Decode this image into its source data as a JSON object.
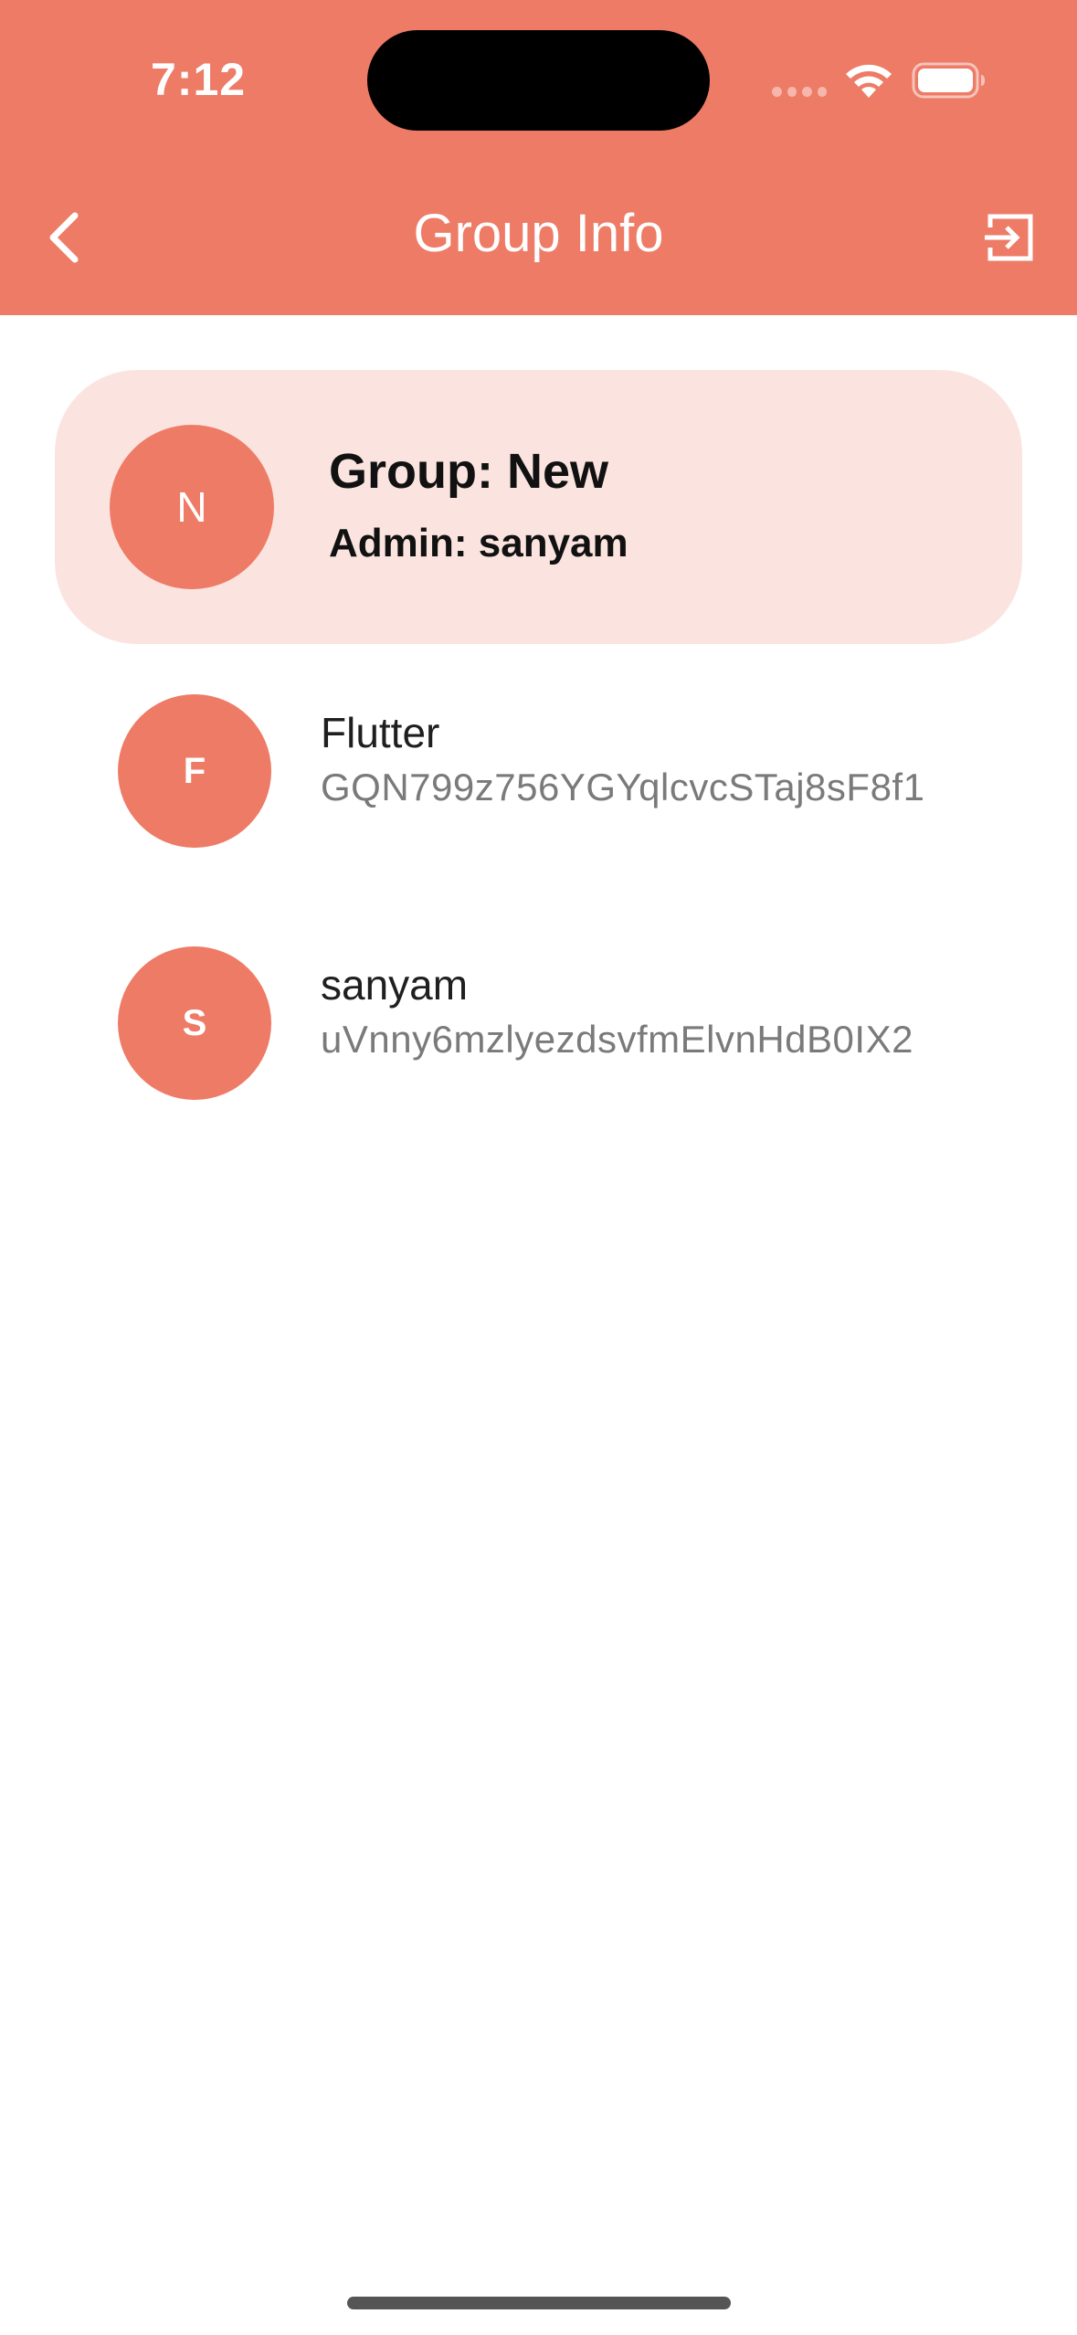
{
  "status_bar": {
    "time": "7:12"
  },
  "header": {
    "title": "Group Info",
    "background_color": "#EE7B66",
    "back_icon": "chevron-left-icon",
    "exit_icon": "exit-to-app-icon"
  },
  "group": {
    "avatar_initial": "N",
    "name_label": "Group: New",
    "admin_label": "Admin: sanyam",
    "card_color": "#FBE4DF"
  },
  "members": [
    {
      "initial": "F",
      "name": "Flutter",
      "id": "GQN799z756YGYqlcvcSTaj8sF8f1"
    },
    {
      "initial": "S",
      "name": "sanyam",
      "id": "uVnny6mzlyezdsvfmElvnHdB0IX2"
    }
  ],
  "accent_color": "#EE7B66"
}
